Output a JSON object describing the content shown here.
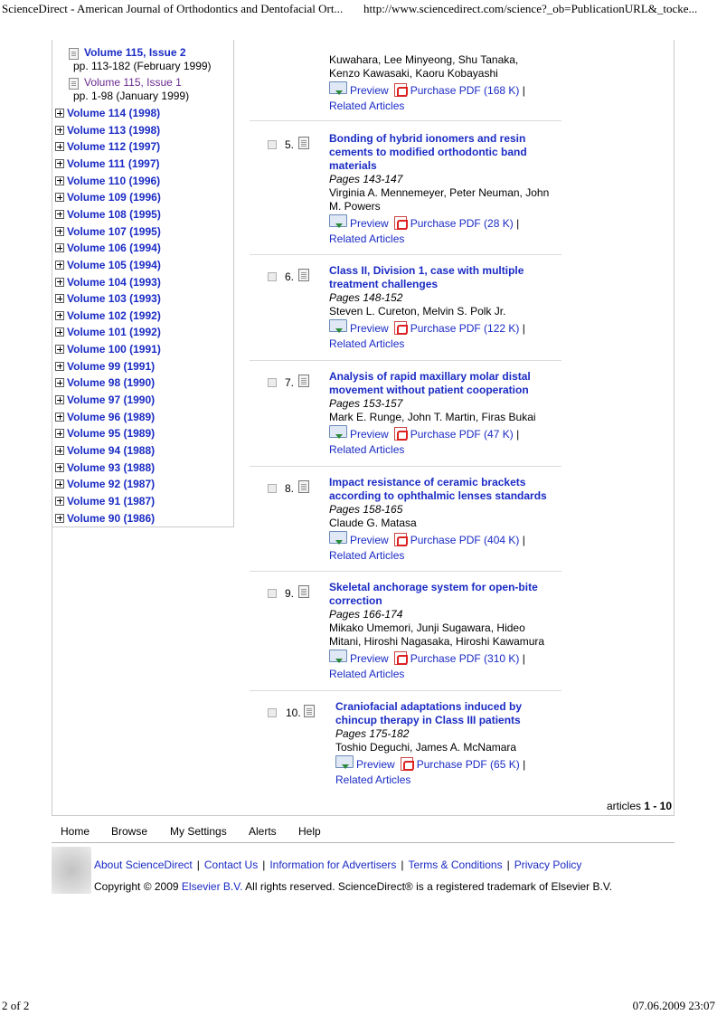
{
  "print_header": {
    "left": "ScienceDirect - American Journal of Orthodontics and Dentofacial Ort...",
    "right": "http://www.sciencedirect.com/science?_ob=PublicationURL&_tocke..."
  },
  "print_footer": {
    "left": "2 of 2",
    "right": "07.06.2009 23:07"
  },
  "sidebar": {
    "issues": [
      {
        "title": "Volume 115, Issue 2",
        "pages": "pp. 113-182 (February 1999)"
      },
      {
        "title": "Volume 115, Issue 1",
        "pages": "pp. 1-98 (January 1999)"
      }
    ],
    "volumes": [
      "Volume 114 (1998)",
      "Volume 113 (1998)",
      "Volume 112 (1997)",
      "Volume 111 (1997)",
      "Volume 110 (1996)",
      "Volume 109 (1996)",
      "Volume 108 (1995)",
      "Volume 107 (1995)",
      "Volume 106 (1994)",
      "Volume 105 (1994)",
      "Volume 104 (1993)",
      "Volume 103 (1993)",
      "Volume 102 (1992)",
      "Volume 101 (1992)",
      "Volume 100 (1991)",
      "Volume 99 (1991)",
      "Volume 98 (1990)",
      "Volume 97 (1990)",
      "Volume 96 (1989)",
      "Volume 95 (1989)",
      "Volume 94 (1988)",
      "Volume 93 (1988)",
      "Volume 92 (1987)",
      "Volume 91 (1987)",
      "Volume 90 (1986)"
    ]
  },
  "first_article_tail": {
    "authors_line1": "Kuwahara, Lee Minyeong, Shu Tanaka,",
    "authors_line2": "Kenzo Kawasaki, Kaoru Kobayashi",
    "preview": "Preview",
    "purchase": "Purchase PDF (168 K)",
    "pipe": "|",
    "related": "Related Articles"
  },
  "articles": [
    {
      "num": "5.",
      "title_lines": [
        "Bonding of hybrid ionomers and resin",
        "cements to modified orthodontic band",
        "materials"
      ],
      "pages": "Pages 143-147",
      "author_lines": [
        "Virginia A. Mennemeyer, Peter Neuman, John",
        "M. Powers"
      ],
      "preview": "Preview",
      "purchase": "Purchase PDF (28 K)",
      "pipe": "|",
      "related": "Related Articles"
    },
    {
      "num": "6.",
      "title_lines": [
        "Class II, Division 1, case with multiple",
        "treatment challenges"
      ],
      "pages": "Pages 148-152",
      "author_lines": [
        "Steven L. Cureton, Melvin S. Polk Jr."
      ],
      "preview": "Preview",
      "purchase": "Purchase PDF (122 K)",
      "pipe": "|",
      "related": "Related Articles"
    },
    {
      "num": "7.",
      "title_lines": [
        "Analysis of rapid maxillary molar distal",
        "movement without patient cooperation"
      ],
      "pages": "Pages 153-157",
      "author_lines": [
        "Mark E. Runge, John T. Martin, Firas Bukai"
      ],
      "preview": "Preview",
      "purchase": "Purchase PDF (47 K)",
      "pipe": "|",
      "related": "Related Articles"
    },
    {
      "num": "8.",
      "title_lines": [
        "Impact resistance of ceramic brackets",
        "according to ophthalmic lenses standards"
      ],
      "pages": "Pages 158-165",
      "author_lines": [
        "Claude G. Matasa"
      ],
      "preview": "Preview",
      "purchase": "Purchase PDF (404 K)",
      "pipe": "|",
      "related": "Related Articles"
    },
    {
      "num": "9.",
      "title_lines": [
        "Skeletal anchorage system for open-bite",
        "correction"
      ],
      "pages": "Pages 166-174",
      "author_lines": [
        "Mikako Umemori, Junji Sugawara, Hideo",
        "Mitani, Hiroshi Nagasaka, Hiroshi Kawamura"
      ],
      "preview": "Preview",
      "purchase": "Purchase PDF (310 K)",
      "pipe": "|",
      "related": "Related Articles"
    },
    {
      "num": "10.",
      "title_lines": [
        "Craniofacial adaptations induced by",
        "chincup therapy in Class III patients"
      ],
      "pages": "Pages 175-182",
      "author_lines": [
        "Toshio Deguchi, James A. McNamara"
      ],
      "preview": "Preview",
      "purchase": "Purchase PDF (65 K)",
      "pipe": "|",
      "related": "Related Articles"
    }
  ],
  "articles_count": {
    "prefix": "articles ",
    "range": "1 - 10"
  },
  "nav": {
    "home": "Home",
    "browse": "Browse",
    "settings": "My Settings",
    "alerts": "Alerts",
    "help": "Help"
  },
  "footer": {
    "links": [
      "About ScienceDirect",
      "Contact Us",
      "Information for Advertisers",
      "Terms & Conditions",
      "Privacy Policy"
    ],
    "separator": "|",
    "copyright_pre": "Copyright © 2009 ",
    "copyright_link": "Elsevier B.V.",
    "copyright_post": " All rights reserved. ScienceDirect® is a registered trademark of Elsevier B.V."
  },
  "colors": {
    "link": "#1a2bc4",
    "visited": "#6b2a8e",
    "border": "#c9c9c9"
  }
}
